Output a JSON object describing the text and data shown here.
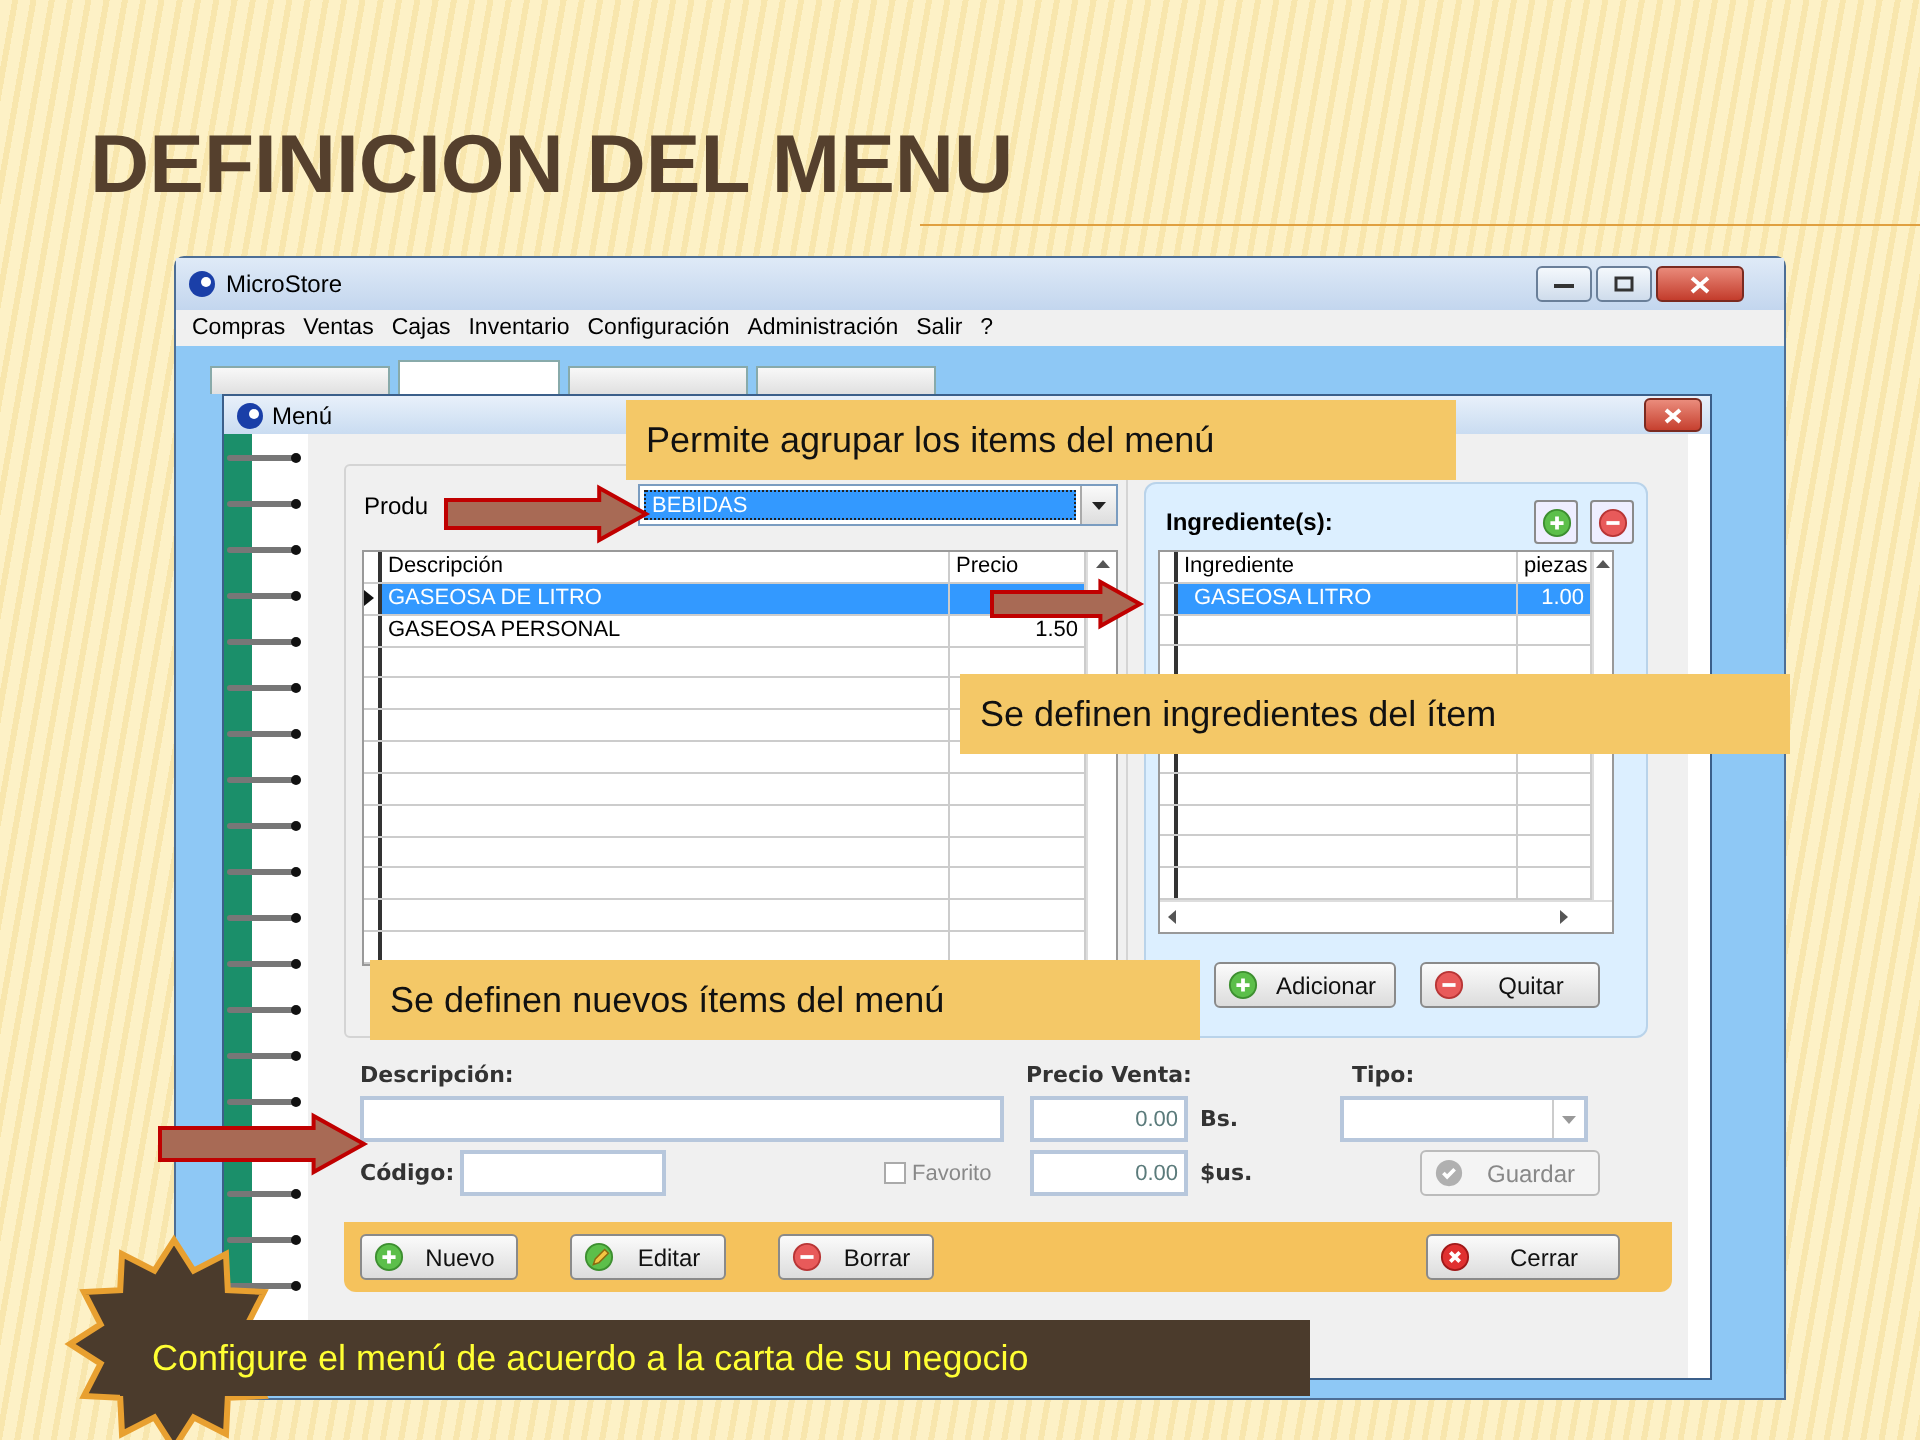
{
  "slide_title": "DEFINICION DEL MENU",
  "window": {
    "title": "MicroStore",
    "menu": [
      "Compras",
      "Ventas",
      "Cajas",
      "Inventario",
      "Configuración",
      "Administración",
      "Salir",
      "?"
    ]
  },
  "tabs": [
    {
      "selected": false
    },
    {
      "selected": true
    },
    {
      "selected": false
    },
    {
      "selected": false
    }
  ],
  "dialog": {
    "title": "Menú",
    "category_label": "Produ",
    "category_value": "BEBIDAS",
    "items_table": {
      "columns": [
        "Descripción",
        "Precio"
      ],
      "rows": [
        {
          "description": "GASEOSA DE LITRO",
          "selected": true
        },
        {
          "description": "GASEOSA PERSONAL",
          "price": "1.50",
          "selected": false
        }
      ]
    },
    "ingredients": {
      "title": "Ingrediente(s):",
      "columns": [
        "Ingrediente",
        "piezas"
      ],
      "rows": [
        {
          "name": "GASEOSA LITRO",
          "pieces": "1.00",
          "selected": true
        }
      ],
      "buttons": [
        {
          "label": "Adicionar",
          "kind": "add"
        },
        {
          "label": "Quitar",
          "kind": "remove"
        }
      ]
    },
    "form": {
      "description_label": "Descripción:",
      "code_label": "Código:",
      "favorite": {
        "label": "Favorito",
        "checked": false
      },
      "price_label": "Precio Venta:",
      "price_bs": "0.00",
      "currency_bs": "Bs.",
      "price_usd": "0.00",
      "currency_usd": "$us.",
      "type_label": "Tipo:",
      "save_button": {
        "label": "Guardar",
        "disabled": true
      }
    },
    "actions": [
      {
        "label": "Nuevo",
        "kind": "add"
      },
      {
        "label": "Editar",
        "kind": "edit"
      },
      {
        "label": "Borrar",
        "kind": "remove"
      },
      {
        "label": "Cerrar",
        "kind": "close"
      }
    ]
  },
  "callouts": [
    "Permite agrupar los items del menú",
    "Se definen ingredientes del ítem",
    "Se definen nuevos ítems del menú"
  ],
  "caption": "Configure el menú de acuerdo a la carta de su negocio"
}
